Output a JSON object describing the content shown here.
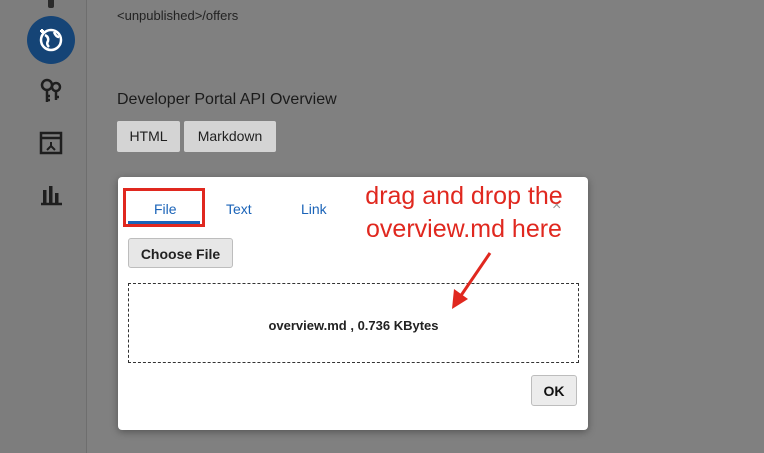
{
  "sidebar": {
    "icons": [
      "partial-icon",
      "globe-api-icon",
      "keys-icon",
      "deployment-icon",
      "analytics-icon"
    ]
  },
  "header": {
    "crumb": "<unpublished>/offers"
  },
  "main": {
    "section_title": "Developer Portal API Overview",
    "tabs": [
      {
        "label": "HTML"
      },
      {
        "label": "Markdown"
      }
    ]
  },
  "popup": {
    "tabs": [
      {
        "label": "File",
        "active": true
      },
      {
        "label": "Text",
        "active": false
      },
      {
        "label": "Link",
        "active": false
      }
    ],
    "close_label": "×",
    "choose_file_label": "Choose File",
    "file_info": "overview.md , 0.736 KBytes",
    "ok_label": "OK"
  },
  "annotation": {
    "line1": "drag and drop the",
    "line2": "overview.md here"
  },
  "colors": {
    "accent": "#1a63b8",
    "annotation_red": "#e0281f",
    "sidebar_active": "#154476",
    "overlay_gray": "#808080"
  }
}
